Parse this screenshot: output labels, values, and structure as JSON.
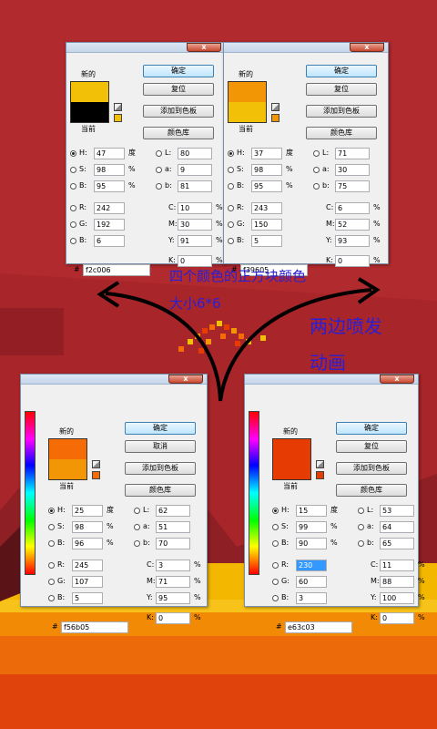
{
  "colors": {
    "background_red": "#a8252a",
    "band_yellow": "#f3b700",
    "band_orange1": "#f28a05",
    "band_orange2": "#ec6a0a",
    "band_orange3": "#e0430c",
    "annotation_blue": "#2a1fd6"
  },
  "annotations": {
    "line1": "四个颜色的正方块颜色",
    "line2": "大小6*6",
    "right1": "两边喷发",
    "right2": "动画"
  },
  "dialogs": [
    {
      "close": "x",
      "new_label": "新的",
      "current_label": "当前",
      "new_color": "#f2c006",
      "current_color": "#000000",
      "btn_ok": "确定",
      "btn_second": "复位",
      "btn_add": "添加到色板",
      "btn_lib": "颜色库",
      "fields": {
        "H": "47",
        "S": "98",
        "B": "95",
        "R": "242",
        "G": "192",
        "Bb": "6",
        "L": "80",
        "a": "9",
        "b": "81",
        "C": "10",
        "M": "30",
        "Y": "91",
        "K": "0",
        "hex": "f2c006"
      },
      "units": {
        "deg": "度",
        "pct": "%"
      },
      "labels": {
        "H": "H:",
        "S": "S:",
        "B": "B:",
        "R": "R:",
        "G": "G:",
        "Bb": "B:",
        "L": "L:",
        "a": "a:",
        "b": "b:",
        "C": "C:",
        "M": "M:",
        "Y": "Y:",
        "K": "K:",
        "hash": "#"
      }
    },
    {
      "close": "x",
      "new_label": "新的",
      "current_label": "当前",
      "new_color": "#f39605",
      "current_color": "#f2c006",
      "btn_ok": "确定",
      "btn_second": "复位",
      "btn_add": "添加到色板",
      "btn_lib": "颜色库",
      "fields": {
        "H": "37",
        "S": "98",
        "B": "95",
        "R": "243",
        "G": "150",
        "Bb": "5",
        "L": "71",
        "a": "30",
        "b": "75",
        "C": "6",
        "M": "52",
        "Y": "93",
        "K": "0",
        "hex": "f39605"
      },
      "units": {
        "deg": "度",
        "pct": "%"
      },
      "labels": {
        "H": "H:",
        "S": "S:",
        "B": "B:",
        "R": "R:",
        "G": "G:",
        "Bb": "B:",
        "L": "L:",
        "a": "a:",
        "b": "b:",
        "C": "C:",
        "M": "M:",
        "Y": "Y:",
        "K": "K:",
        "hash": "#"
      }
    },
    {
      "close": "x",
      "new_label": "新的",
      "current_label": "当前",
      "new_color": "#f56b05",
      "current_color": "#f39605",
      "btn_ok": "确定",
      "btn_second": "取消",
      "btn_add": "添加到色板",
      "btn_lib": "颜色库",
      "fields": {
        "H": "25",
        "S": "98",
        "B": "96",
        "R": "245",
        "G": "107",
        "Bb": "5",
        "L": "62",
        "a": "51",
        "b": "70",
        "C": "3",
        "M": "71",
        "Y": "95",
        "K": "0",
        "hex": "f56b05"
      },
      "units": {
        "deg": "度",
        "pct": "%"
      },
      "labels": {
        "H": "H:",
        "S": "S:",
        "B": "B:",
        "R": "R:",
        "G": "G:",
        "Bb": "B:",
        "L": "L:",
        "a": "a:",
        "b": "b:",
        "C": "C:",
        "M": "M:",
        "Y": "Y:",
        "K": "K:",
        "hash": "#"
      }
    },
    {
      "close": "x",
      "new_label": "新的",
      "current_label": "当前",
      "new_color": "#e63c03",
      "current_color": "#e63c03",
      "btn_ok": "确定",
      "btn_second": "复位",
      "btn_add": "添加到色板",
      "btn_lib": "颜色库",
      "fields": {
        "H": "15",
        "S": "99",
        "B": "90",
        "R": "230",
        "G": "60",
        "Bb": "3",
        "L": "53",
        "a": "64",
        "b": "65",
        "C": "11",
        "M": "88",
        "Y": "100",
        "K": "0",
        "hex": "e63c03"
      },
      "units": {
        "deg": "度",
        "pct": "%"
      },
      "labels": {
        "H": "H:",
        "S": "S:",
        "B": "B:",
        "R": "R:",
        "G": "G:",
        "Bb": "B:",
        "L": "L:",
        "a": "a:",
        "b": "b:",
        "C": "C:",
        "M": "M:",
        "Y": "Y:",
        "K": "K:",
        "hash": "#"
      }
    }
  ]
}
